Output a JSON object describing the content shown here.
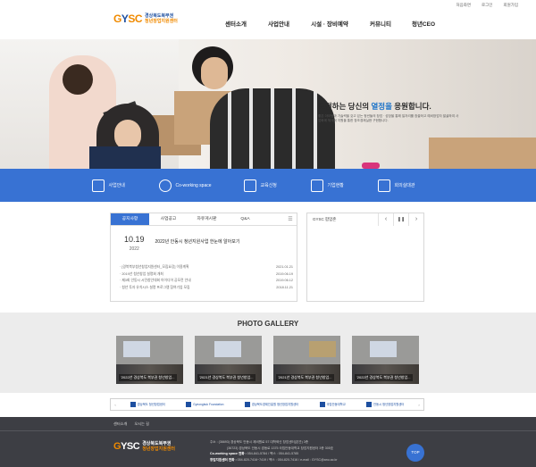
{
  "util": [
    "처음화면",
    "로그인",
    "회원가입"
  ],
  "logo": {
    "mark_y": "Y",
    "mark_sc": "SC",
    "mark_g": "G",
    "line1": "경상북도북부권",
    "line2": "청년창업지원센터"
  },
  "gnb": [
    "센터소개",
    "사업안내",
    "시설 · 장비예약",
    "커뮤니티",
    "청년CEO"
  ],
  "hero": {
    "title_pre": "도전하는 당신의 ",
    "title_em": "열정을",
    "title_post": " 응원합니다.",
    "desc": "좋은 아이템과 기술력을 갖고 있는 청년들의 창업 · 성장을 통해 일자리를 창출하고 예비창업자 발굴하여 사업화에 체계적 지원을 통한 창조경제실현 구현합니다."
  },
  "quick": [
    "사업안내",
    "Co-working space",
    "교육신청",
    "기업현황",
    "회의실대관"
  ],
  "notice": {
    "tabs": [
      "공지사항",
      "사업공고",
      "자유게시판",
      "Q&A"
    ],
    "menu_icon": "☰",
    "feature": {
      "date": "10.19",
      "year": "2022",
      "title": "2022년 안동시 청년지원사업 한눈에 알아보기"
    },
    "posts": [
      {
        "title": "· [경북북부청년창업지원센터_모집요강] 이용계획",
        "date": "2021.01.21"
      },
      {
        "title": "· 2019년 청년창업 설명회 개최",
        "date": "2019.06.19"
      },
      {
        "title": "· 제3회 안동시 시민창안대회 아이디어 공모전 안내",
        "date": "2019.06.12"
      },
      {
        "title": "· 청년 투자 유치시스 설명 프로그램 참여기업 모집",
        "date": "2018.11.21"
      }
    ]
  },
  "panel2": {
    "title": "GYSC 팝업존",
    "prev": "‹",
    "pause": "❚❚",
    "next": "›"
  },
  "gallery": {
    "title": "PHOTO GALLERY",
    "items": [
      "'2022년 경상북도 북부권 청년창업...",
      "'2021년 경상북도 북부권 청년창업...",
      "'2021년 경상북도 북부권 청년창업...",
      "'2022년 경상북도 북부권 청년창업..."
    ]
  },
  "partners": {
    "prev": "‹",
    "next": "›",
    "logos": [
      "경상북도 청년창업센터",
      "Gyeongbuk Foundation",
      "경상북도경제진흥원 청년창업지원센터",
      "국립안동대학교",
      "안동시 청년창업지원센터"
    ]
  },
  "footer": {
    "links": [
      "센터소개",
      "오시는 길"
    ],
    "addr": "주소 : (36693) 경상북도 안동시 제비원로 57 대학혁신 창업센터(본관) 3층",
    "addr2": "(36723) 경상북도 안동시 경동로 1375 국립안동대학교 창업지원센터 3층 305호",
    "cws_label": "Co-working space 전화 :",
    "cws": " 054-841-5784 / 팩스 : 054-841-5785",
    "center_label": "창업지원센터 전화 :",
    "center": " 054-820-7416~7419 / 팩스 : 054-820-7416 / e-mail : GYSC@anu.ac.kr",
    "top": "TOP"
  },
  "colors": {
    "brand_blue": "#3872d3",
    "brand_orange": "#f08a00",
    "footer": "#3d3e44"
  }
}
